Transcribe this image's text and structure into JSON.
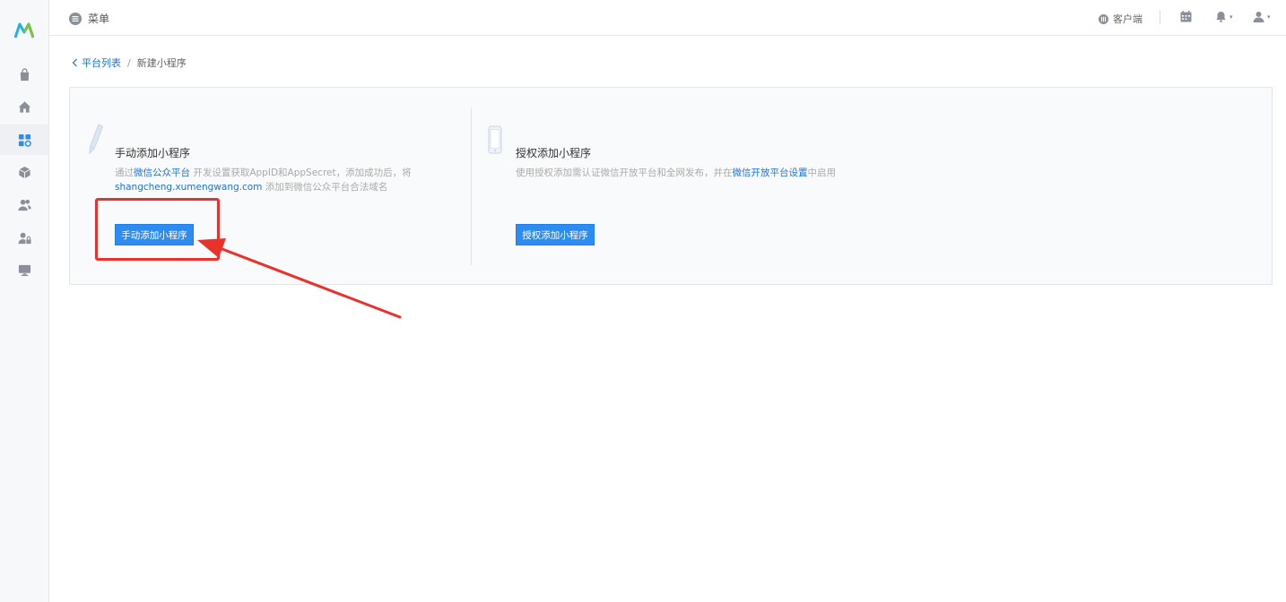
{
  "topbar": {
    "menu_label": "菜单",
    "client_label": "客户端"
  },
  "sidebar": {
    "items": [
      {
        "icon": "shopping-bag-icon"
      },
      {
        "icon": "home-icon"
      },
      {
        "icon": "apps-icon",
        "active": true
      },
      {
        "icon": "package-icon"
      },
      {
        "icon": "users-icon"
      },
      {
        "icon": "user-lock-icon"
      },
      {
        "icon": "monitor-icon"
      }
    ]
  },
  "breadcrumb": {
    "back_label": "平台列表",
    "separator": "/",
    "current": "新建小程序"
  },
  "manual_card": {
    "title": "手动添加小程序",
    "desc_prefix": "通过",
    "desc_link1": "微信公众平台",
    "desc_mid": " 开发设置获取AppID和AppSecret，添加成功后，将",
    "desc_link2": "shangcheng.xumengwang.com",
    "desc_suffix": " 添加到微信公众平台合法域名",
    "button_label": "手动添加小程序"
  },
  "auth_card": {
    "title": "授权添加小程序",
    "desc_prefix": "使用授权添加需认证微信开放平台和全网发布，并在",
    "desc_link": "微信开放平台设置",
    "desc_suffix": "中启用",
    "button_label": "授权添加小程序"
  },
  "colors": {
    "primary": "#2d8cf0",
    "link": "#1a73d9",
    "annotation_red": "#e8322b"
  }
}
